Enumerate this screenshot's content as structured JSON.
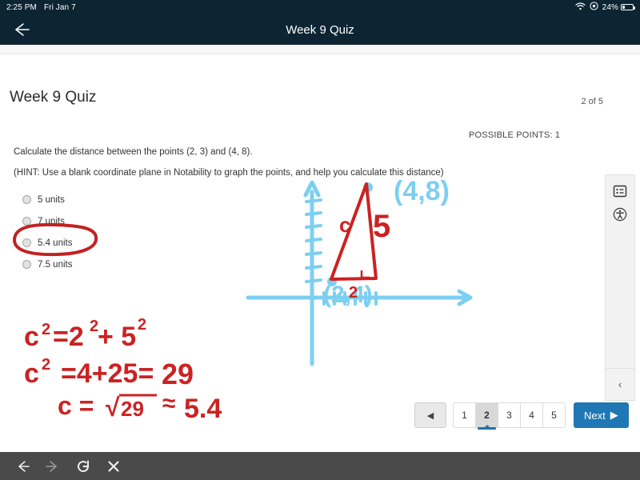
{
  "status_bar": {
    "time": "2:25 PM",
    "date": "Fri Jan 7",
    "battery_percent": "24%",
    "wifi_icon": "wifi-icon",
    "record_icon": "screen-record-icon"
  },
  "nav": {
    "title": "Week 9 Quiz",
    "back_icon": "back-arrow-icon"
  },
  "quiz": {
    "title": "Week 9 Quiz",
    "page_counter": "2 of 5",
    "possible_points": "POSSIBLE POINTS: 1",
    "question": "Calculate the distance between the points (2, 3) and (4, 8).",
    "hint": "(HINT:  Use a blank coordinate plane in Notability to graph the points, and help you calculate this distance)",
    "options": [
      {
        "label": "5 units",
        "selected": false
      },
      {
        "label": "7 units",
        "selected": false
      },
      {
        "label": "5.4 units",
        "selected": false
      },
      {
        "label": "7.5 units",
        "selected": false
      }
    ],
    "annotated_option": "5.4 units"
  },
  "pagination": {
    "prev_label": "◀",
    "pages": [
      "1",
      "2",
      "3",
      "4",
      "5"
    ],
    "active_page": "2",
    "next_label": "Next",
    "next_arrow": "▶"
  },
  "right_rail": {
    "outline_icon": "outline-panel-icon",
    "accessibility_icon": "accessibility-icon",
    "collapse_label": "‹"
  },
  "annotations": {
    "ink_blue_color": "#7dcff0",
    "ink_red_color": "#cc2222",
    "graph_point_label_1": "(4,8)",
    "graph_point_label_2": "(2,4)",
    "triangle_hypotenuse_label": "c",
    "triangle_vertical_label": "5",
    "triangle_horizontal_label": "2",
    "work_line_1": "c² =2²+ 5²",
    "work_line_2": "c²  =4+25=  29",
    "work_line_3": "c = √29  ≈ 5.4"
  },
  "bottom_toolbar": {
    "back_icon": "browser-back-icon",
    "forward_icon": "browser-forward-icon",
    "reload_icon": "reload-icon",
    "close_icon": "close-icon"
  },
  "colors": {
    "header": "#0d2433",
    "accent_blue": "#1f78b4",
    "toolbar": "#4a4a4a"
  }
}
